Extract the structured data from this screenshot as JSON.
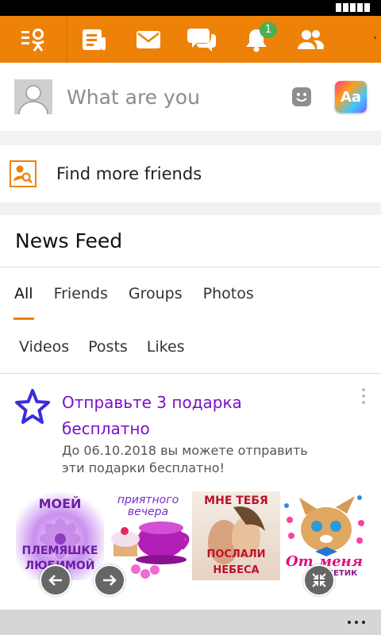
{
  "colors": {
    "accent": "#ee8208",
    "link_purple": "#7a10c6",
    "badge_green": "#4caf50"
  },
  "topbar": {
    "icons": [
      "ok-logo-icon",
      "feed-icon",
      "mail-icon",
      "chat-icon",
      "bell-icon",
      "friends-icon"
    ],
    "notification_count": "1"
  },
  "composer": {
    "placeholder": "What are you",
    "icons": [
      "smile-icon",
      "text-style-icon"
    ],
    "style_button_label": "Aa"
  },
  "find_friends": {
    "label": "Find more friends",
    "icon": "find-friends-icon"
  },
  "feed": {
    "title": "News Feed",
    "tabs_row1": [
      {
        "label": "All",
        "active": true
      },
      {
        "label": "Friends"
      },
      {
        "label": "Groups"
      },
      {
        "label": "Photos"
      }
    ],
    "tabs_row2": [
      {
        "label": "Videos"
      },
      {
        "label": "Posts"
      },
      {
        "label": "Likes"
      }
    ],
    "post": {
      "title": "Отправьте 3 подарка бесплатно",
      "description": "До 06.10.2018 вы можете отправить эти подарки бесплатно!",
      "gifts": [
        {
          "top": "МОЕЙ",
          "bottom": "ПЛЕМЯШКЕ ЛЮБИМОЙ"
        },
        {
          "top": "приятного вечера",
          "bottom": ""
        },
        {
          "top": "МНЕ ТЕБЯ",
          "bottom": "ПОСЛАЛИ НЕБЕСА"
        },
        {
          "top": "",
          "bottom": "От меня",
          "sub": "ЗЕТИК"
        }
      ]
    }
  }
}
